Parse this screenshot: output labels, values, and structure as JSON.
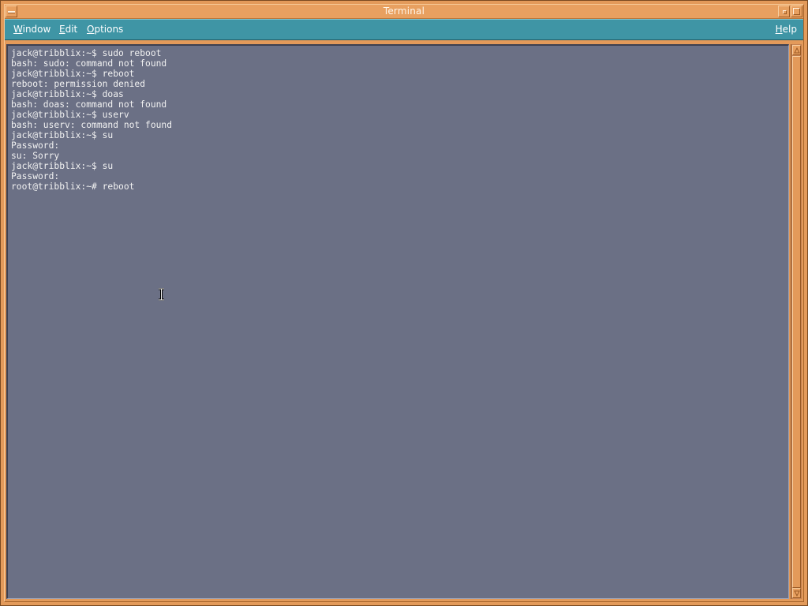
{
  "window": {
    "title": "Terminal"
  },
  "menubar": {
    "window_label": "Window",
    "window_mnemonic": "W",
    "window_rest": "indow",
    "edit_mnemonic": "E",
    "edit_rest": "dit",
    "options_mnemonic": "O",
    "options_rest": "ptions",
    "help_mnemonic": "H",
    "help_rest": "elp"
  },
  "terminal": {
    "lines": [
      "jack@tribblix:~$ sudo reboot",
      "bash: sudo: command not found",
      "jack@tribblix:~$ reboot",
      "reboot: permission denied",
      "jack@tribblix:~$ doas",
      "bash: doas: command not found",
      "jack@tribblix:~$ userv",
      "bash: userv: command not found",
      "jack@tribblix:~$ su",
      "Password:",
      "su: Sorry",
      "jack@tribblix:~$ su",
      "Password:",
      "root@tribblix:~# reboot"
    ]
  },
  "icons": {
    "window_menu": "window-menu-icon",
    "minimize": "minimize-icon",
    "maximize": "maximize-icon",
    "text_cursor": "text-cursor-icon",
    "scroll_up": "arrow-up-icon",
    "scroll_down": "arrow-down-icon"
  },
  "colors": {
    "frame": "#e39a5a",
    "menubar": "#3f95a5",
    "terminal_bg": "#6b7085",
    "terminal_fg": "#f2f2f2"
  }
}
